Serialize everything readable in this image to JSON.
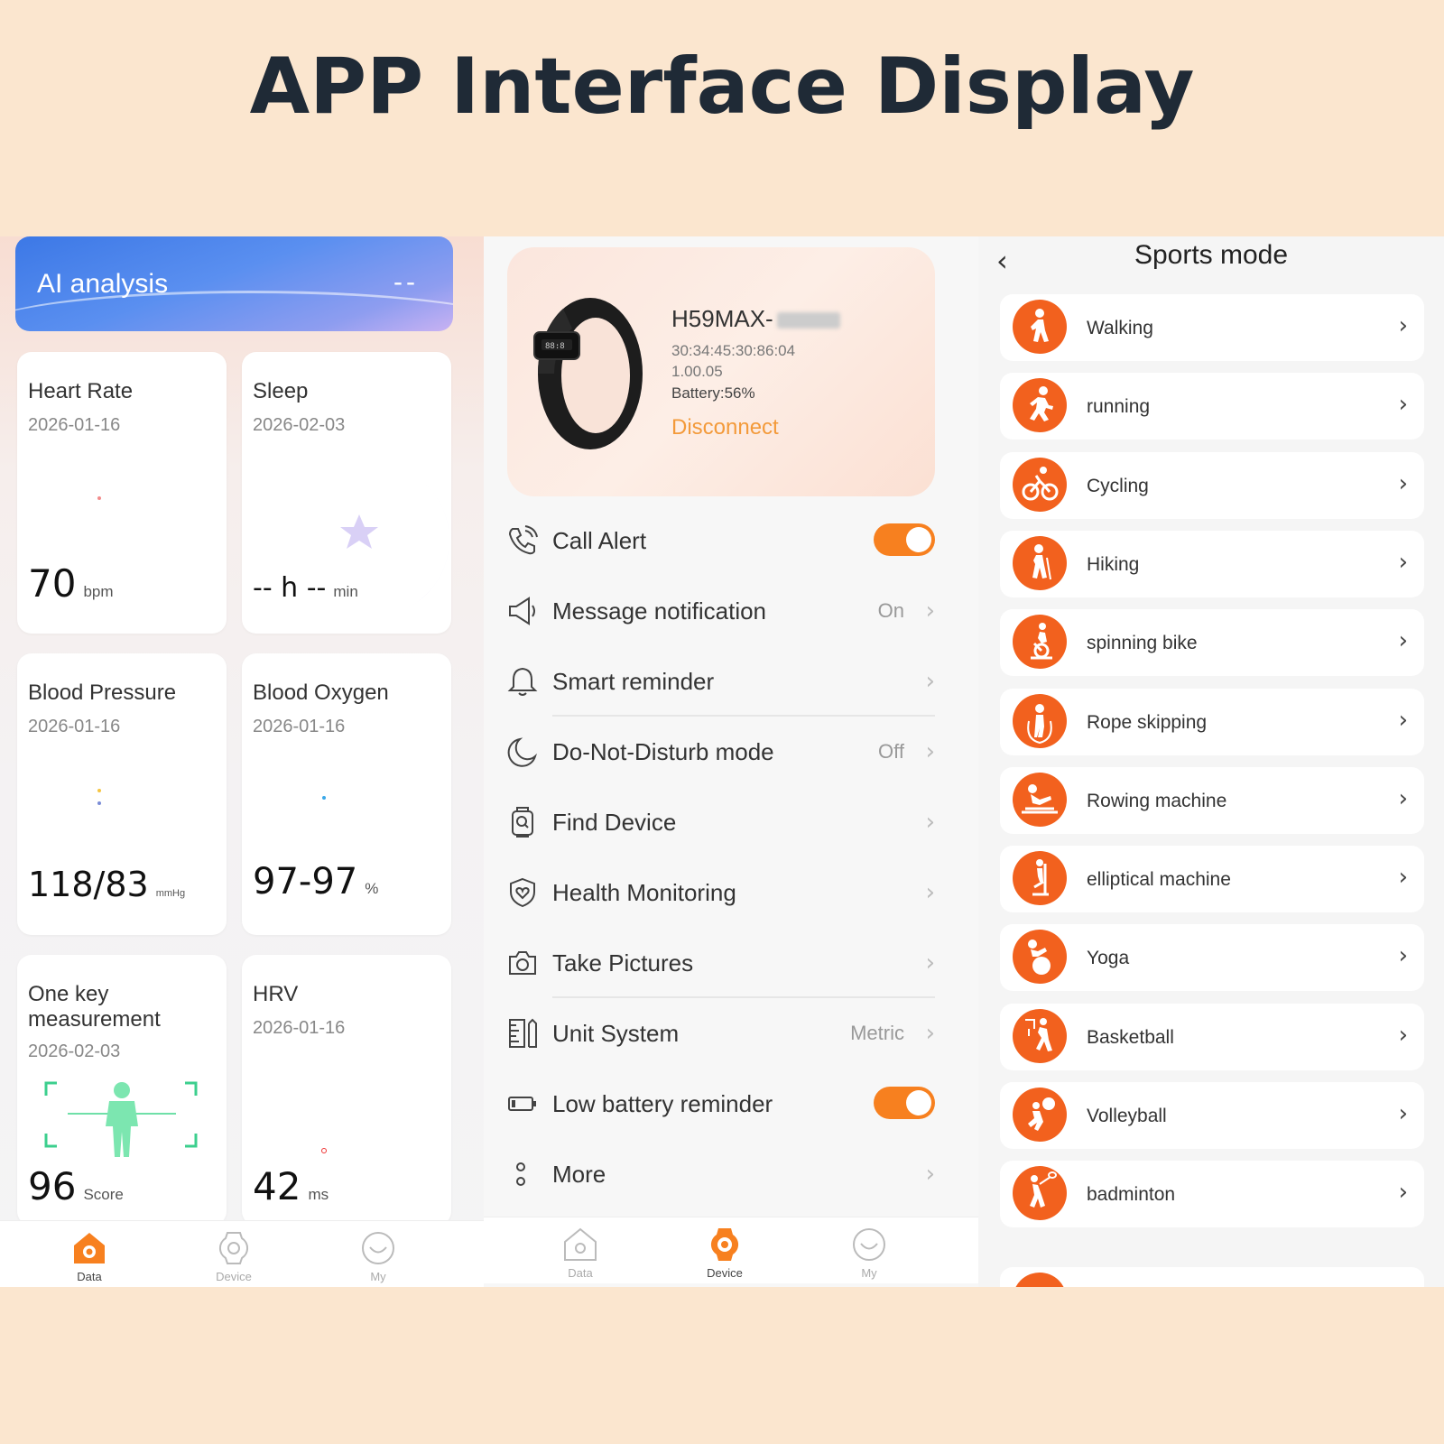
{
  "banner": {
    "title": "APP Interface Display"
  },
  "data_screen": {
    "ai_card": {
      "title": "AI analysis",
      "value": "--"
    },
    "cards": [
      {
        "title": "Heart Rate",
        "date": "2026-01-16",
        "value": "70",
        "unit": "bpm"
      },
      {
        "title": "Sleep",
        "date": "2026-02-03",
        "value": "-- h --",
        "unit": "min"
      },
      {
        "title": "Blood Pressure",
        "date": "2026-01-16",
        "value": "118/83",
        "unit": "mmHg"
      },
      {
        "title": "Blood Oxygen",
        "date": "2026-01-16",
        "value": "97-97",
        "unit": "%"
      },
      {
        "title": "One key measurement",
        "date": "2026-02-03",
        "value": "96",
        "unit": "Score"
      },
      {
        "title": "HRV",
        "date": "2026-01-16",
        "value": "42",
        "unit": "ms"
      }
    ],
    "tabs": [
      {
        "label": "Data",
        "icon": "home-icon",
        "active": true
      },
      {
        "label": "Device",
        "icon": "watch-icon",
        "active": false
      },
      {
        "label": "My",
        "icon": "smile-icon",
        "active": false
      }
    ]
  },
  "device_screen": {
    "device": {
      "name": "H59MAX-",
      "mac": "30:34:45:30:86:04",
      "version": "1.00.05",
      "battery": "Battery:56%",
      "disconnect": "Disconnect"
    },
    "settings": [
      {
        "label": "Call Alert",
        "icon": "phone-icon",
        "toggle": true,
        "on": true
      },
      {
        "label": "Message notification",
        "icon": "speaker-icon",
        "value": "On"
      },
      {
        "label": "Smart reminder",
        "icon": "bell-icon",
        "value": ""
      },
      {
        "label": "Do-Not-Disturb mode",
        "icon": "moon-icon",
        "value": "Off"
      },
      {
        "label": "Find Device",
        "icon": "find-watch-icon",
        "value": ""
      },
      {
        "label": "Health Monitoring",
        "icon": "shield-heart-icon",
        "value": ""
      },
      {
        "label": "Take Pictures",
        "icon": "camera-icon",
        "value": ""
      },
      {
        "label": "Unit System",
        "icon": "ruler-icon",
        "value": "Metric"
      },
      {
        "label": "Low battery reminder",
        "icon": "battery-icon",
        "toggle": true,
        "on": true
      },
      {
        "label": "More",
        "icon": "more-dots-icon",
        "value": ""
      }
    ],
    "tabs": [
      {
        "label": "Data",
        "icon": "home-icon",
        "active": false
      },
      {
        "label": "Device",
        "icon": "watch-icon",
        "active": true
      },
      {
        "label": "My",
        "icon": "smile-icon",
        "active": false
      }
    ]
  },
  "sports_screen": {
    "title": "Sports mode",
    "items": [
      {
        "label": "Walking",
        "icon": "walking-icon"
      },
      {
        "label": "running",
        "icon": "running-icon"
      },
      {
        "label": "Cycling",
        "icon": "cycling-icon"
      },
      {
        "label": "Hiking",
        "icon": "hiking-icon"
      },
      {
        "label": "spinning bike",
        "icon": "spinning-bike-icon"
      },
      {
        "label": "Rope skipping",
        "icon": "rope-skipping-icon"
      },
      {
        "label": "Rowing machine",
        "icon": "rowing-icon"
      },
      {
        "label": "elliptical machine",
        "icon": "elliptical-icon"
      },
      {
        "label": "Yoga",
        "icon": "yoga-icon"
      },
      {
        "label": "Basketball",
        "icon": "basketball-icon"
      },
      {
        "label": "Volleyball",
        "icon": "volleyball-icon"
      },
      {
        "label": "badminton",
        "icon": "badminton-icon"
      }
    ]
  },
  "colors": {
    "accent": "#f7801f",
    "sport_icon": "#f2611e",
    "background": "#fbe6cf",
    "title": "#1f2a36"
  }
}
